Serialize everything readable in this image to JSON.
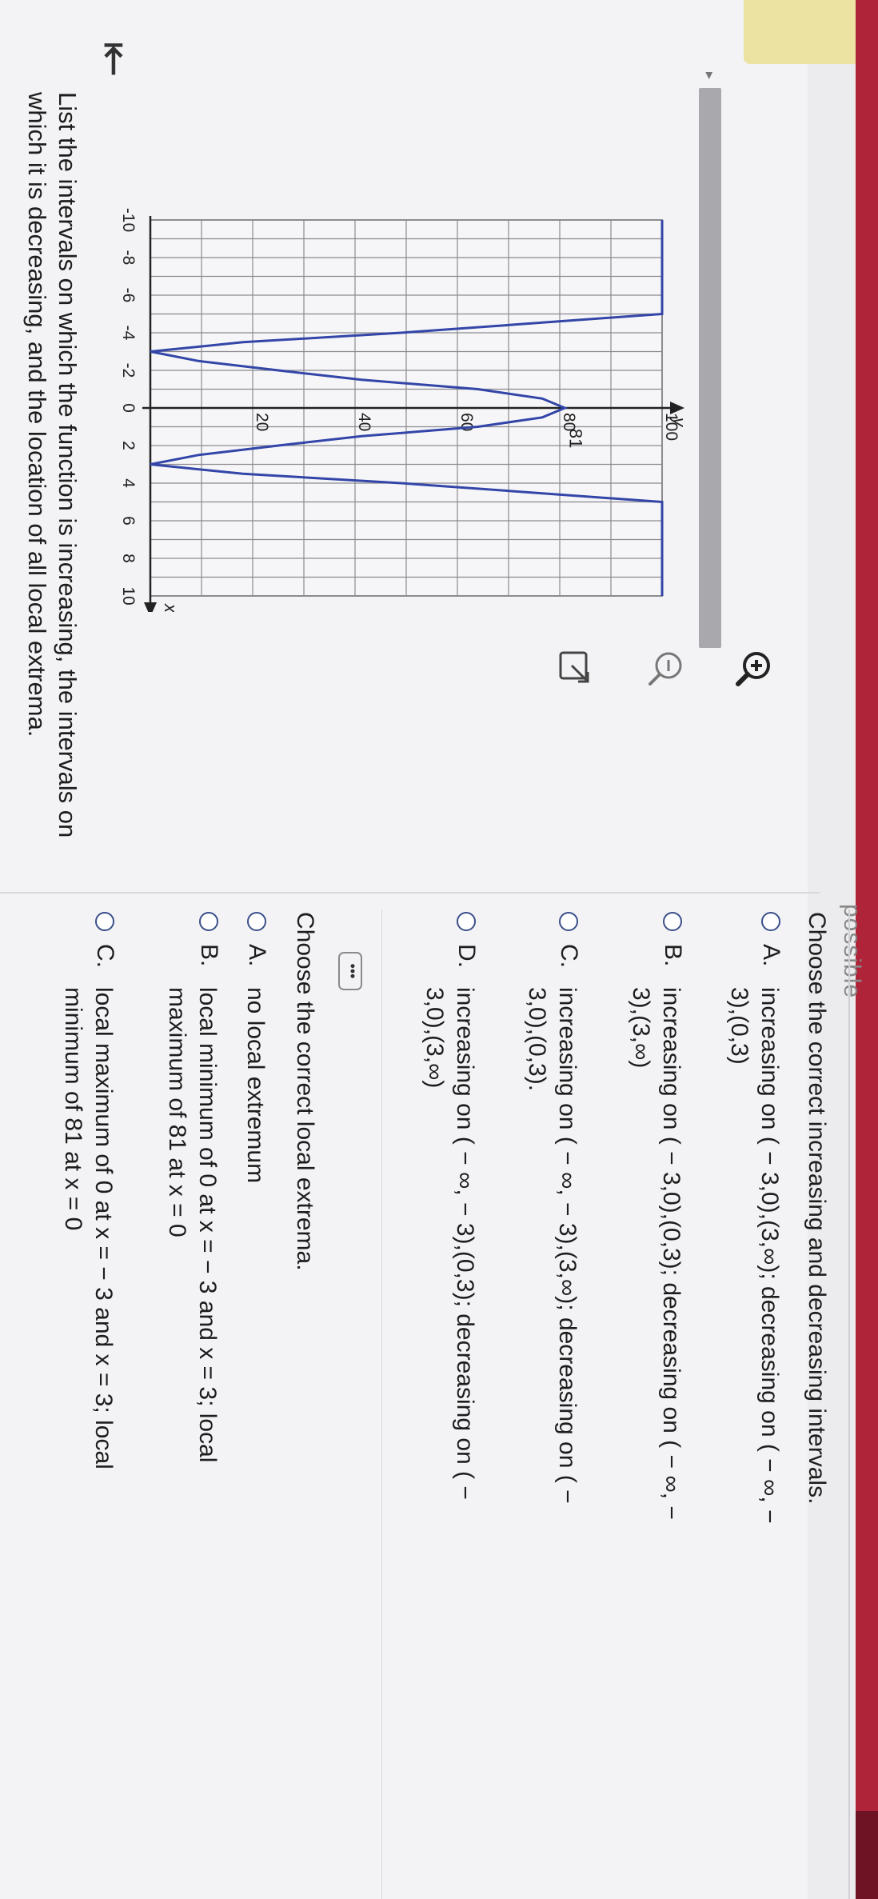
{
  "header": {
    "ghost_title": "possible"
  },
  "nav": {
    "back_icon": "back-arrow-icon",
    "back_glyph": "⇤"
  },
  "question": {
    "text": "List the intervals on which the function is increasing, the intervals on which it is decreasing, and the location of all local extrema."
  },
  "graph": {
    "y_axis_label": "y",
    "x_axis_label": "x",
    "y_ticks": [
      "100",
      "80",
      "60",
      "40",
      "20"
    ],
    "x_ticks": [
      "-10",
      "-8",
      "-6",
      "-4",
      "-2",
      "0",
      "2",
      "4",
      "6",
      "8",
      "10"
    ],
    "point_label": "81",
    "curve_color": "#3346a8",
    "grid_color": "#8b8b90"
  },
  "chart_data": {
    "type": "line",
    "title": "",
    "xlabel": "x",
    "ylabel": "y",
    "xlim": [
      -10,
      10
    ],
    "ylim": [
      0,
      100
    ],
    "grid": true,
    "series": [
      {
        "x": [
          -10,
          -8,
          -6,
          -5,
          -4,
          -3.5,
          -3,
          -2.5,
          -2,
          -1.5,
          -1,
          -0.5,
          0,
          0.5,
          1,
          1.5,
          2,
          2.5,
          3,
          3.5,
          4,
          5,
          6,
          8,
          10
        ],
        "y": [
          100,
          100,
          100,
          100,
          49,
          18.1,
          0,
          9.4,
          25,
          41.3,
          64,
          76.6,
          81,
          76.6,
          64,
          41.3,
          25,
          9.4,
          0,
          18.1,
          49,
          100,
          100,
          100,
          100
        ]
      }
    ],
    "annotations": [
      {
        "text": "81",
        "x": 0,
        "y": 81
      }
    ]
  },
  "tools": {
    "zoom_in_icon": "zoom-in-icon",
    "zoom_out_icon": "zoom-out-icon",
    "popout_icon": "external-link-icon"
  },
  "more_button": {
    "label": "•••"
  },
  "q1": {
    "prompt": "Choose the correct increasing and decreasing intervals.",
    "options": [
      {
        "letter": "A.",
        "text": "increasing on ( − 3,0),(3,∞); decreasing on ( − ∞, − 3),(0,3)"
      },
      {
        "letter": "B.",
        "text": "increasing on ( − 3,0),(0,3); decreasing on ( − ∞, − 3),(3,∞)"
      },
      {
        "letter": "C.",
        "text": "increasing on ( − ∞, − 3),(3,∞); decreasing on ( − 3,0),(0,3)."
      },
      {
        "letter": "D.",
        "text": "increasing on ( − ∞, − 3),(0,3); decreasing on ( − 3,0),(3,∞)"
      }
    ]
  },
  "q2": {
    "prompt": "Choose the correct local extrema.",
    "options": [
      {
        "letter": "A.",
        "text": "no local extremum"
      },
      {
        "letter": "B.",
        "text": "local minimum of 0 at x = − 3 and x = 3; local maximum of 81 at x = 0"
      },
      {
        "letter": "C.",
        "text": "local maximum of 0 at x = − 3 and x = 3; local minimum of 81 at x = 0"
      }
    ]
  },
  "colors": {
    "accent": "#b0243a",
    "radio_border": "#3a4f8a"
  }
}
